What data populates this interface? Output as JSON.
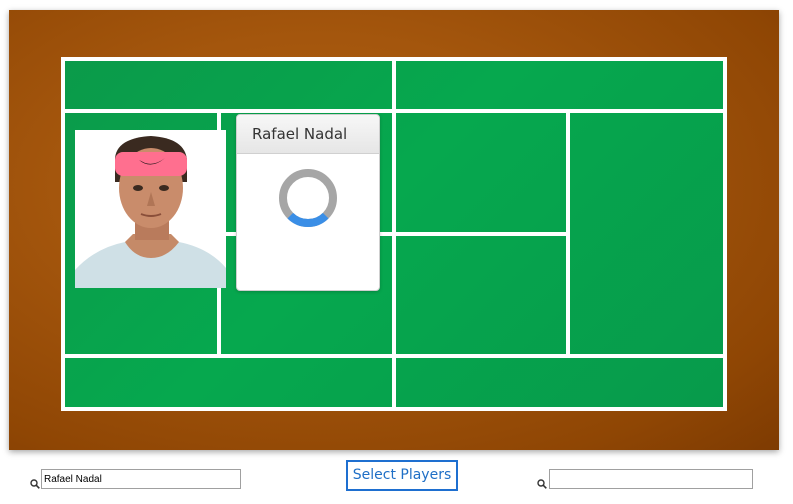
{
  "court": {
    "surround_color": "#9a4f08",
    "surface_color": "#05a04c",
    "line_color": "#ffffff"
  },
  "card": {
    "player_name": "Rafael Nadal",
    "photo_icon": "player-headshot",
    "loading_icon": "loading-spinner"
  },
  "footer": {
    "left_search": {
      "value": "Rafael Nadal",
      "placeholder": ""
    },
    "select_button_label": "Select Players",
    "right_search": {
      "value": "",
      "placeholder": ""
    },
    "search_icon": "magnifier-icon",
    "accent_color": "#1e6fd0"
  }
}
